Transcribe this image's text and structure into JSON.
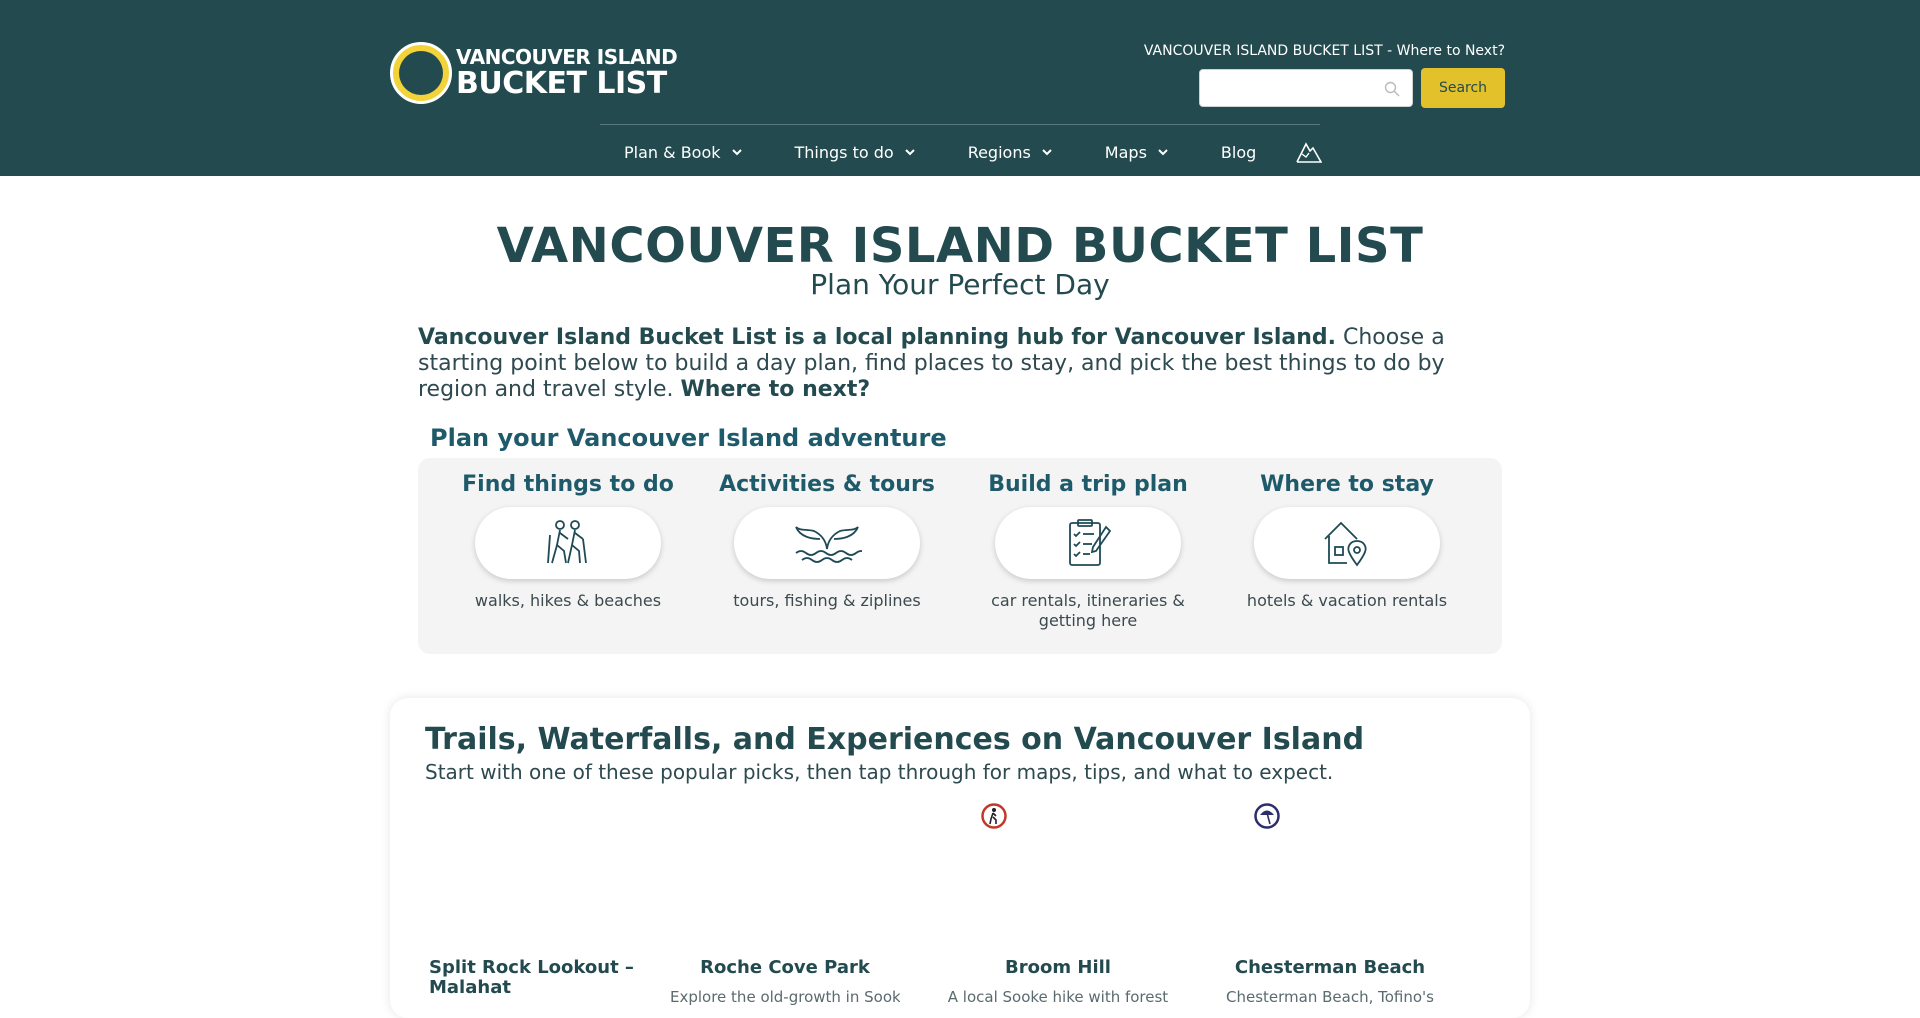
{
  "header": {
    "logo_line1": "VANCOUVER ISLAND",
    "logo_line2": "BUCKET LIST",
    "tagline": "VANCOUVER ISLAND BUCKET LIST - Where to Next?",
    "search_placeholder": "",
    "search_button": "Search",
    "nav": [
      {
        "label": "Plan & Book",
        "has_dropdown": true
      },
      {
        "label": "Things to do",
        "has_dropdown": true
      },
      {
        "label": "Regions",
        "has_dropdown": true
      },
      {
        "label": "Maps",
        "has_dropdown": true
      },
      {
        "label": "Blog",
        "has_dropdown": false
      }
    ],
    "nav_icon": "mountain-icon",
    "colors": {
      "header_bg": "#234a4f",
      "accent": "#e2c12b"
    }
  },
  "hero": {
    "title": "VANCOUVER ISLAND BUCKET LIST",
    "subtitle": "Plan Your Perfect Day",
    "intro_bold": "Vancouver Island Bucket List is a local planning hub for Vancouver Island.",
    "intro_text": " Choose a starting point below to build a day plan, find places to stay, and pick the best things to do by region and travel style. ",
    "intro_bold_end": "Where to next?"
  },
  "plan": {
    "title": "Plan your Vancouver Island adventure",
    "cards": [
      {
        "title": "Find things to do",
        "subtitle": "walks, hikes & beaches",
        "icon": "hikers-icon"
      },
      {
        "title": "Activities & tours",
        "subtitle": "tours, fishing & ziplines",
        "icon": "whale-tail-icon"
      },
      {
        "title": "Build a trip plan",
        "subtitle": "car rentals, itineraries & getting here",
        "icon": "checklist-icon"
      },
      {
        "title": "Where to stay",
        "subtitle": "hotels & vacation rentals",
        "icon": "house-pin-icon"
      }
    ]
  },
  "trails": {
    "title": "Trails, Waterfalls, and Experiences on Vancouver Island",
    "subtitle": "Start with one of these popular picks, then tap through for maps, tips, and what to expect.",
    "places": [
      {
        "name": "Split Rock Lookout – Malahat",
        "desc": ""
      },
      {
        "name": "Roche Cove Park",
        "desc": "Explore the old-growth in Sooke"
      },
      {
        "name": "Broom Hill",
        "desc": "A local Sooke hike with forest"
      },
      {
        "name": "Chesterman Beach",
        "desc": "Chesterman Beach, Tofino's"
      }
    ],
    "badges": [
      "hiker-badge-icon",
      "beach-umbrella-badge-icon"
    ]
  }
}
